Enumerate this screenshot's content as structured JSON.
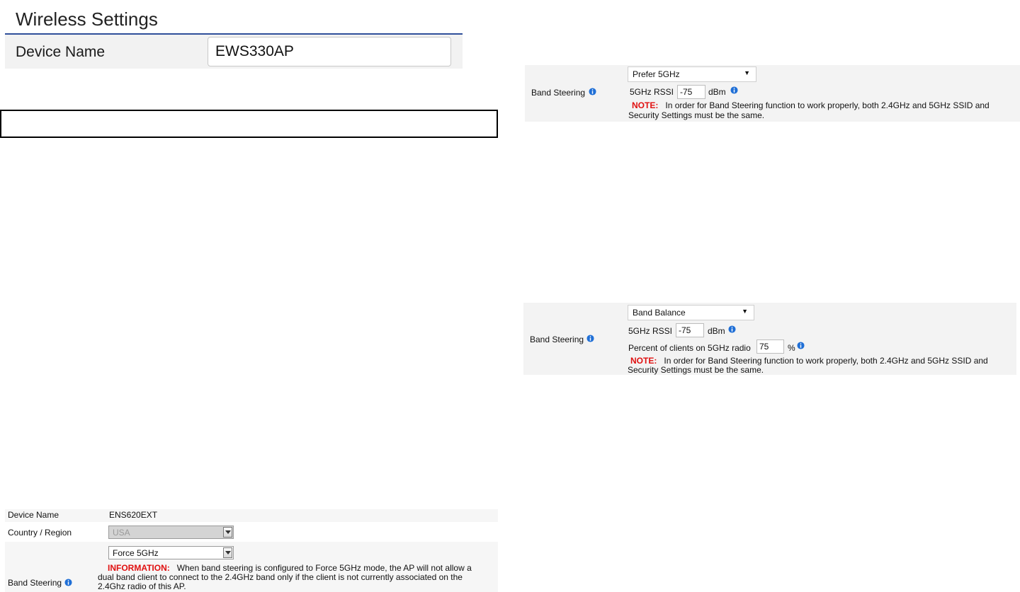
{
  "wireless_settings": {
    "title": "Wireless Settings",
    "device_name_label": "Device Name",
    "device_name_value": "EWS330AP"
  },
  "band_steering_prefer": {
    "label": "Band Steering",
    "mode": "Prefer 5GHz",
    "rssi_label": "5GHz RSSI",
    "rssi_value": "-75",
    "rssi_unit": "dBm",
    "note_label": "NOTE:",
    "note_line1": "In order for Band Steering function to work properly, both 2.4GHz and 5GHz SSID and",
    "note_line2": "Security Settings must be the same."
  },
  "band_steering_balance": {
    "label": "Band Steering",
    "mode": "Band Balance",
    "rssi_label": "5GHz RSSI",
    "rssi_value": "-75",
    "rssi_unit": "dBm",
    "percent_label": "Percent of clients on 5GHz radio",
    "percent_value": "75",
    "percent_unit": "%",
    "note_label": "NOTE:",
    "note_line1": "In order for Band Steering function to work properly, both 2.4GHz and 5GHz SSID and",
    "note_line2": "Security Settings must be the same."
  },
  "extender_settings": {
    "device_name_label": "Device Name",
    "device_name_value": "ENS620EXT",
    "country_label": "Country / Region",
    "country_value": "USA",
    "band_steering_label": "Band Steering",
    "band_steering_mode": "Force 5GHz",
    "info_label": "INFORMATION:",
    "info_line1": "When band steering is configured to Force 5GHz mode, the AP will not allow a",
    "info_line2": "dual band client to connect to the 2.4GHz band only if the client is not currently associated on the",
    "info_line3": "2.4Ghz radio of this AP."
  },
  "colors": {
    "accent_rule": "#2f4f9a",
    "note_red": "#e01010",
    "info_blue": "#1f6fd6",
    "row_background": "#f3f3f3"
  }
}
